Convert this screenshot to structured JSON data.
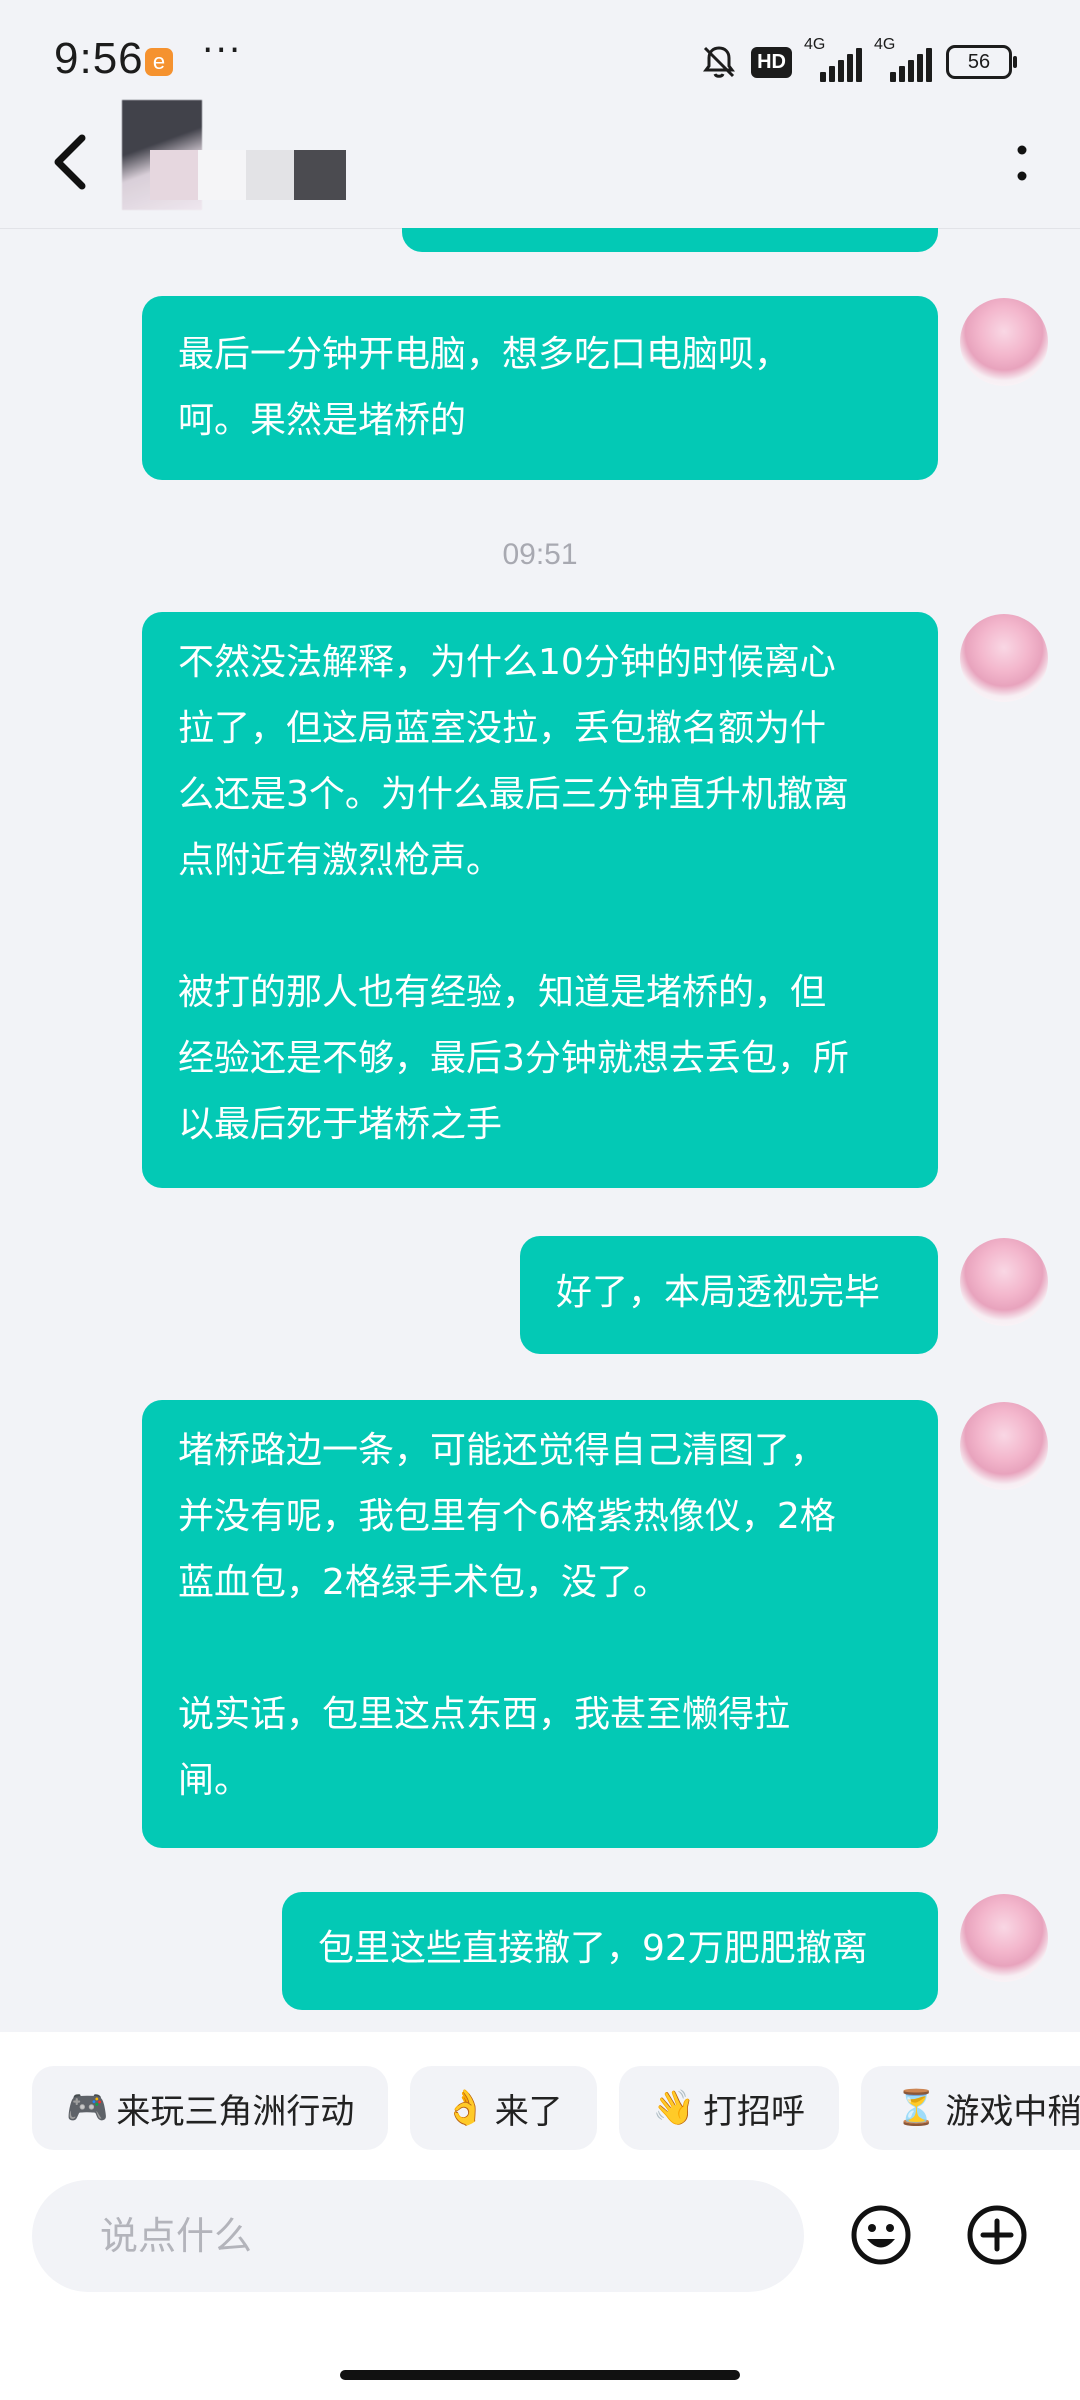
{
  "status_bar": {
    "time": "9:56",
    "app_badge": "e",
    "overflow": "···",
    "hd_label": "HD",
    "signal1_label": "4G",
    "signal2_label": "4G",
    "battery": "56"
  },
  "header": {
    "back_icon": "chevron-left-icon",
    "more_icon": "vertical-dots-icon"
  },
  "messages": [
    {
      "id": "partial",
      "text": ""
    },
    {
      "id": "m1",
      "text": "最后一分钟开电脑，想多吃口电脑呗，\n呵。果然是堵桥的"
    },
    {
      "id": "m2",
      "text": "不然没法解释，为什么10分钟的时候离心\n拉了，但这局蓝室没拉，丢包撤名额为什\n么还是3个。为什么最后三分钟直升机撤离\n点附近有激烈枪声。\n\n被打的那人也有经验，知道是堵桥的，但\n经验还是不够，最后3分钟就想去丢包，所\n以最后死于堵桥之手"
    },
    {
      "id": "m3",
      "text": "好了，本局透视完毕"
    },
    {
      "id": "m4",
      "text": "堵桥路边一条，可能还觉得自己清图了，\n并没有呢，我包里有个6格紫热像仪，2格\n蓝血包，2格绿手术包，没了。\n\n说实话，包里这点东西，我甚至懒得拉\n闸。"
    },
    {
      "id": "m5",
      "text": "包里这些直接撤了，92万肥肥撤离"
    }
  ],
  "timestamp": "09:51",
  "quick_replies": [
    {
      "icon": "🎮",
      "label": "来玩三角洲行动"
    },
    {
      "icon": "👌",
      "label": "来了"
    },
    {
      "icon": "👋",
      "label": "打招呼"
    },
    {
      "icon": "⏳",
      "label": "游戏中稍等"
    }
  ],
  "input": {
    "placeholder": "说点什么",
    "value": ""
  },
  "colors": {
    "bubble": "#03c9b5",
    "background": "#f2f3f7",
    "panel": "#ffffff"
  }
}
